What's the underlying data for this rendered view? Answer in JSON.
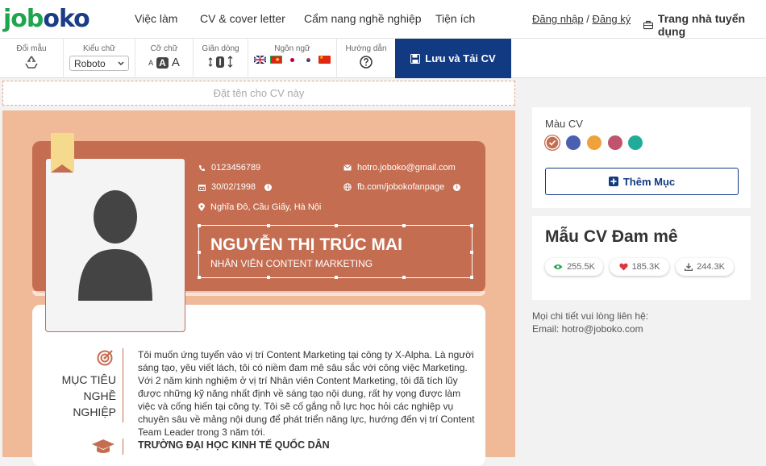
{
  "brand": {
    "logo_text_1": "job",
    "logo_text_2": "oko"
  },
  "nav": {
    "items": [
      "Việc làm",
      "CV & cover letter",
      "Cẩm nang nghề nghiệp",
      "Tiện ích"
    ],
    "login": "Đăng nhập",
    "separator": "/",
    "register": "Đăng ký",
    "recruiter": "Trang nhà tuyển dụng"
  },
  "toolbar": {
    "color_label": "Đổi mẫu",
    "font_label": "Kiểu chữ",
    "font_value": "Roboto",
    "size_label": "Cỡ chữ",
    "spacing_label": "Giãn dòng",
    "language_label": "Ngôn ngữ",
    "guide_label": "Hướng dẫn",
    "size_glyph": "A",
    "spacing_glyph": "I",
    "save_label": "Lưu và Tải CV"
  },
  "cv": {
    "name_placeholder": "Đặt tên cho CV này",
    "phone": "0123456789",
    "dob": "30/02/1998",
    "address": "Nghĩa Đô, Cầu Giấy, Hà Nội",
    "email": "hotro.joboko@gmail.com",
    "facebook": "fb.com/jobokofanpage",
    "full_name": "NGUYỄN THỊ TRÚC MAI",
    "job_title": "NHÂN VIÊN CONTENT MARKETING",
    "objective_title_1": "MỤC TIÊU",
    "objective_title_2": "NGHỀ NGHIỆP",
    "objective_text": "Tôi muốn ứng tuyển vào vị trí Content Marketing tại công ty X-Alpha. Là người sáng tạo, yêu viết lách, tôi có niềm đam mê sâu sắc với công việc Marketing. Với 2 năm kinh nghiệm ở vị trí Nhân viên Content Marketing, tôi đã tích lũy được những kỹ năng nhất định về sáng tạo nội dung, rất hy vọng được làm việc và cống hiến tại công ty. Tôi sẽ cố gắng nỗ lực học hỏi các nghiệp vụ chuyên sâu về mảng nội dung để phát triển năng lực, hướng đến vị trí Content Team Leader trong 3 năm tới.",
    "education_title": "TRƯỜNG ĐẠI HỌC KINH TẾ QUỐC DÂN"
  },
  "sidebar": {
    "color_label": "Màu CV",
    "colors": [
      "#c46d51",
      "#4a5fb0",
      "#f0a23a",
      "#c0536d",
      "#23ab9a"
    ],
    "add_section": "Thêm Mục",
    "template_name": "Mẫu CV Đam mê",
    "views": "255.5K",
    "likes": "185.3K",
    "downloads": "244.3K",
    "contact_line_1": "Mọi chi tiết vui lòng liên hệ:",
    "contact_line_2": "Email: hotro@joboko.com"
  },
  "colors": {
    "primary": "#123a82",
    "cv_accent": "#c46d51",
    "cv_bg": "#f0b998"
  }
}
